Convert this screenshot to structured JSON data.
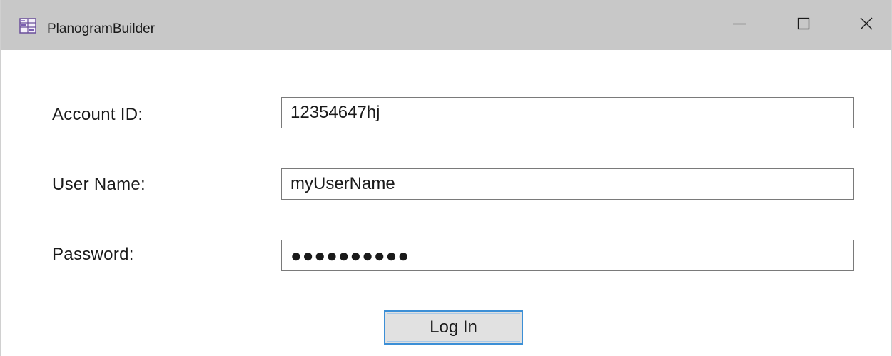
{
  "window": {
    "title": "PlanogramBuilder",
    "icon": "app-icon",
    "controls": {
      "minimize": "minimize-icon",
      "maximize": "maximize-icon",
      "close": "close-icon"
    }
  },
  "form": {
    "account_id": {
      "label": "Account ID:",
      "value": "12354647hj"
    },
    "user_name": {
      "label": "User Name:",
      "value": "myUserName"
    },
    "password": {
      "label": "Password:",
      "value": "●●●●●●●●●●"
    },
    "login_label": "Log In"
  },
  "colors": {
    "titlebar": "#c8c8c8",
    "button_focus_border": "#3c8fd6",
    "button_face": "#e1e1e1"
  }
}
